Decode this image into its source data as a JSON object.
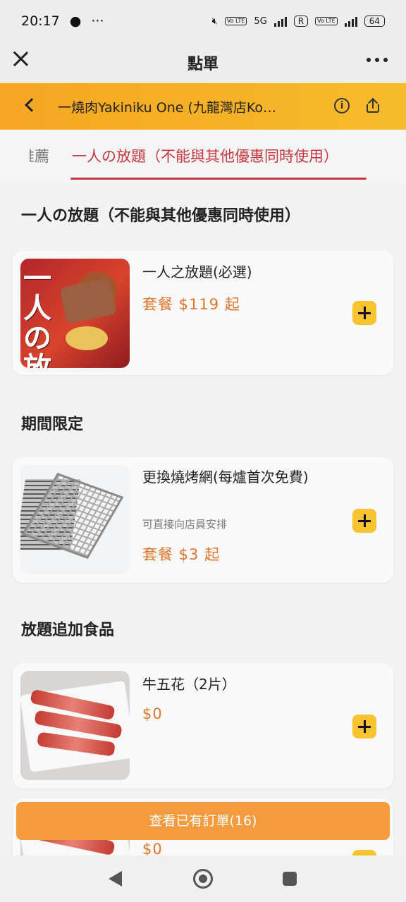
{
  "status_bar": {
    "time": "20:17",
    "network": "5G",
    "battery": "64",
    "volte": "Vo LTE",
    "r_icon": "R"
  },
  "title_bar": {
    "title": "點單"
  },
  "store": {
    "name": "一燒肉Yakiniku One (九龍灣店Ko…"
  },
  "tabs": {
    "previous": "推薦",
    "active": "一人の放題（不能與其他優惠同時使用）"
  },
  "sections": [
    {
      "title": "一人の放題（不能與其他優惠同時使用）",
      "items": [
        {
          "name": "一人之放題(必選)",
          "price": "套餐 $119 起",
          "image": "buffet-poster",
          "image_text": "一人の放題"
        }
      ]
    },
    {
      "title": "期間限定",
      "items": [
        {
          "name": "更換燒烤網(每爐首次免費)",
          "subtitle": "可直接向店員安排",
          "price": "套餐 $3 起",
          "image": "grill-net"
        }
      ]
    },
    {
      "title": "放題追加食品",
      "items": [
        {
          "name": "牛五花（2片）",
          "price": "$0",
          "image": "beef-slices"
        },
        {
          "name": "",
          "price": "$0",
          "image": "beef-slices"
        }
      ]
    }
  ],
  "order_bar": {
    "label": "查看已有訂單(16)"
  },
  "colors": {
    "accent": "#f5a623",
    "price": "#e0742a",
    "tab_active": "#c6373f",
    "order_bar": "#f49a3f",
    "add_button": "#f7c32e"
  },
  "icons": [
    "close-icon",
    "more-icon",
    "back-icon",
    "info-icon",
    "share-icon",
    "add-icon",
    "nav-back-icon",
    "nav-home-icon",
    "nav-recent-icon"
  ]
}
